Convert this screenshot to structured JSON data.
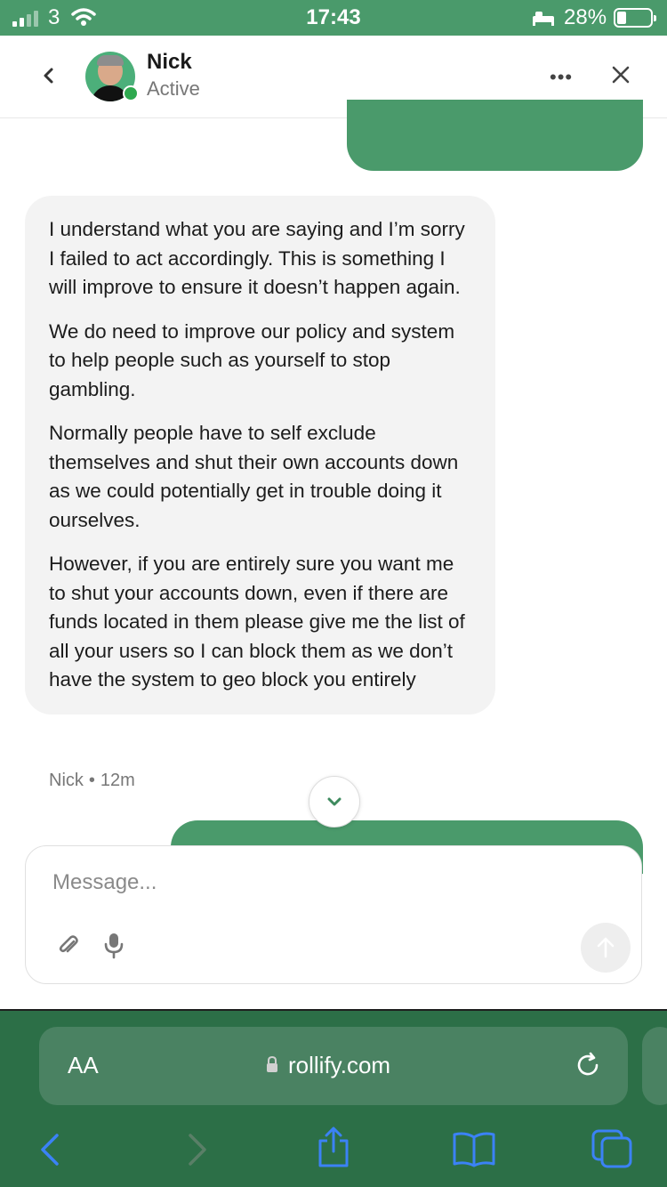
{
  "status_bar": {
    "carrier": "3",
    "time": "17:43",
    "battery": "28%"
  },
  "header": {
    "contact_name": "Nick",
    "contact_status": "Active",
    "more_label": "•••"
  },
  "messages": {
    "incoming": {
      "paragraphs": [
        "I understand what you are saying and I’m sorry I failed to act accordingly. This is something I will improve to ensure it doesn’t happen again.",
        "We do need to improve our policy and system to help people such as yourself to stop gambling.",
        "Normally people have to self exclude themselves and shut their own accounts down as we could potentially get in trouble doing it ourselves.",
        "However, if you are entirely sure you want me to shut your accounts down, even if there are funds located in them please give me the list of all your users so I can block them as we don’t have the system to geo block you entirely"
      ],
      "sender": "Nick",
      "separator": "•",
      "time": "12m"
    }
  },
  "composer": {
    "placeholder": "Message..."
  },
  "browser": {
    "text_size_label": "AA",
    "url": "rollify.com"
  }
}
